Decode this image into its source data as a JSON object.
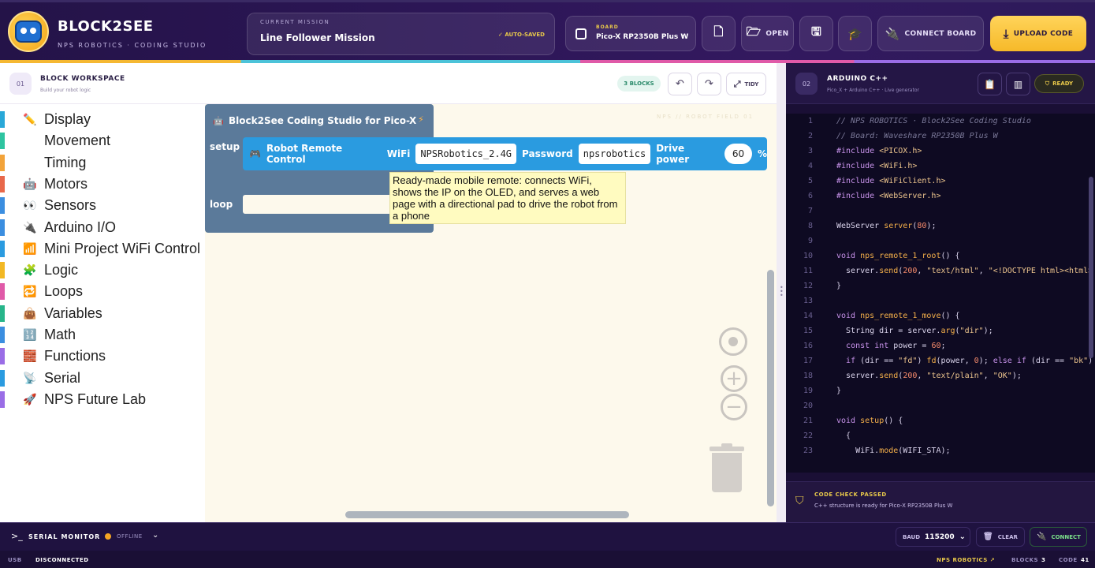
{
  "header": {
    "brand_title": "BLOCK2SEE",
    "brand_subtitle": "NPS ROBOTICS · CODING STUDIO",
    "mission_label": "CURRENT MISSION",
    "mission_title": "Line Follower Mission",
    "autosaved": "✓ AUTO-SAVED",
    "board_label": "BOARD",
    "board_value": "Pico-X RP2350B Plus W",
    "open_label": "OPEN",
    "connect_label": "CONNECT BOARD",
    "upload_label": "UPLOAD CODE"
  },
  "workspace": {
    "num": "01",
    "title": "BLOCK WORKSPACE",
    "subtitle": "Build your robot logic",
    "blocks_badge": "3 BLOCKS",
    "tidy_label": "TIDY",
    "watermark": "NPS // ROBOT FIELD 01"
  },
  "toolbox": [
    {
      "label": "Display",
      "color": "#29a8d8",
      "icon": "✏️"
    },
    {
      "label": "Movement",
      "color": "#2ec4a0",
      "icon": "⚙"
    },
    {
      "label": "Timing",
      "color": "#f2a33a",
      "icon": "⏱"
    },
    {
      "label": "Motors",
      "color": "#e8684a",
      "icon": "🤖"
    },
    {
      "label": "Sensors",
      "color": "#3b8ee0",
      "icon": "👀"
    },
    {
      "label": "Arduino I/O",
      "color": "#3b8ee0",
      "icon": "🔌"
    },
    {
      "label": "Mini Project WiFi Control",
      "color": "#2a9be0",
      "icon": "📶"
    },
    {
      "label": "Logic",
      "color": "#f2b824",
      "icon": "🧩"
    },
    {
      "label": "Loops",
      "color": "#e05aa8",
      "icon": "🔁"
    },
    {
      "label": "Variables",
      "color": "#27b58a",
      "icon": "👜"
    },
    {
      "label": "Math",
      "color": "#3b8ee0",
      "icon": "🔢"
    },
    {
      "label": "Functions",
      "color": "#9a6de6",
      "icon": "🧱"
    },
    {
      "label": "Serial",
      "color": "#2a9be0",
      "icon": "📡"
    },
    {
      "label": "NPS Future Lab",
      "color": "#9a6de6",
      "icon": "🚀"
    }
  ],
  "blocks": {
    "main_title": "Block2See Coding Studio for Pico-X",
    "setup_label": "setup",
    "loop_label": "loop",
    "remote_title": "Robot Remote Control",
    "wifi_label": "WiFi",
    "wifi_value": "NPSRobotics_2.4G",
    "password_label": "Password",
    "password_value": "npsrobotics",
    "drive_label": "Drive power",
    "drive_value": "60",
    "percent": "%",
    "tooltip": "Ready-made mobile remote: connects WiFi, shows the IP on the OLED, and serves a web page with a directional pad to drive the robot from a phone"
  },
  "code": {
    "num": "02",
    "title": "ARDUINO C++",
    "subtitle": "Pico_X + Arduino C++ · Live generator",
    "ready_label": "READY",
    "lines": [
      "1",
      "2",
      "3",
      "4",
      "5",
      "6",
      "7",
      "8",
      "9",
      "10",
      "11",
      "12",
      "13",
      "14",
      "15",
      "16",
      "17",
      "18",
      "19",
      "20",
      "21",
      "22",
      "23"
    ],
    "check_title": "CODE CHECK PASSED",
    "check_desc": "C++ structure is ready for Pico-X RP2350B Plus W"
  },
  "serial": {
    "title": "SERIAL MONITOR",
    "status": "OFFLINE",
    "baud_label": "BAUD",
    "baud_value": "115200",
    "clear_label": "CLEAR",
    "connect_label": "CONNECT"
  },
  "statusbar": {
    "usb_label": "USB",
    "usb_value": "DISCONNECTED",
    "brand": "NPS ROBOTICS ↗",
    "blocks_label": "BLOCKS",
    "blocks_value": "3",
    "code_label": "CODE",
    "code_value": "41"
  },
  "colors": {
    "accent_yellow": "#f6b929",
    "header_bg": "#2c1656",
    "block_blue": "#2a9be0",
    "block_slate": "#5b7a9a"
  }
}
